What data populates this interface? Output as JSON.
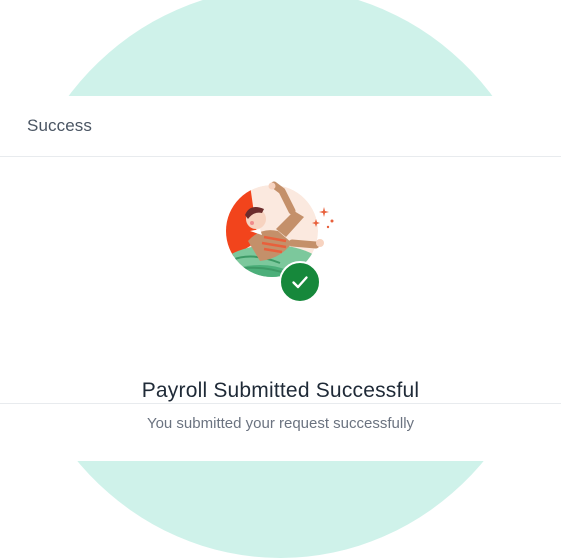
{
  "modal": {
    "title": "Success",
    "headline": "Payroll Submitted Successful",
    "message": "You submitted your request successfully"
  },
  "illustration": {
    "icon": "person-celebrating-illustration",
    "badge_icon": "check-icon"
  },
  "colors": {
    "backdrop_circle": "#cff2ea",
    "success_green": "#16883b",
    "heading_text": "#1f2a37",
    "muted_text": "#6b7380"
  }
}
